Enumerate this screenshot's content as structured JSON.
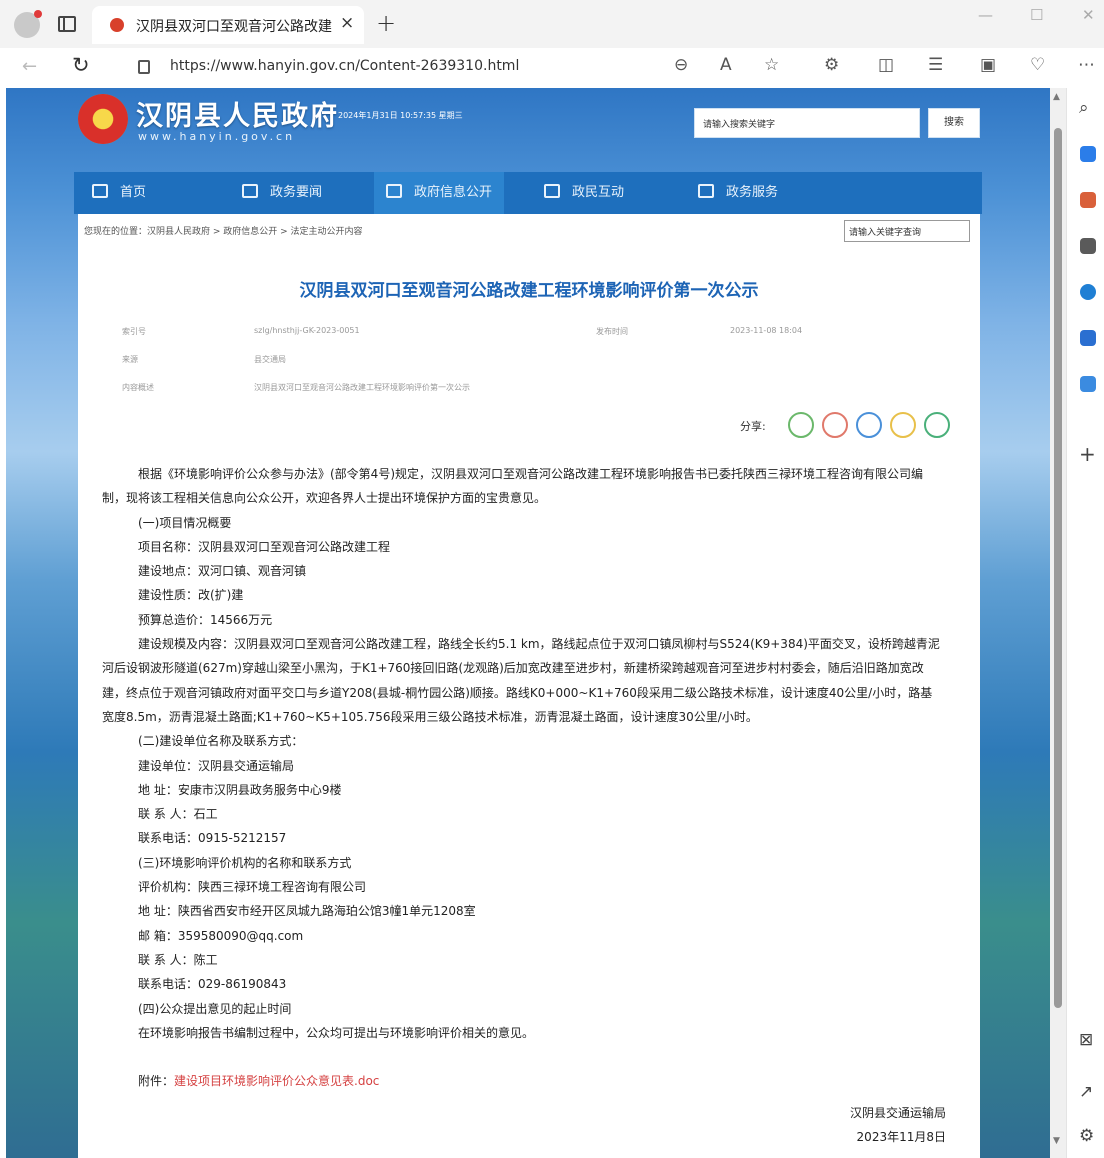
{
  "browser": {
    "tab_title": "汉阴县双河口至观音河公路改建",
    "tab_close": "×",
    "tab_new": "+",
    "url": "https://www.hanyin.gov.cn/Content-2639310.html",
    "window": {
      "minimize": "—",
      "maximize": "☐",
      "close": "✕"
    }
  },
  "site": {
    "name": "汉阴县人民政府",
    "domain": "www.hanyin.gov.cn",
    "datetime": "2024年1月31日 10:57:35 星期三",
    "search_placeholder": "请输入搜索关键字",
    "search_button": "搜索"
  },
  "nav": {
    "items": [
      {
        "label": "首页",
        "icon": "home-icon"
      },
      {
        "label": "政务要闻",
        "icon": "news-icon"
      },
      {
        "label": "政府信息公开",
        "icon": "info-icon"
      },
      {
        "label": "政民互动",
        "icon": "chat-icon"
      },
      {
        "label": "政务服务",
        "icon": "service-icon"
      }
    ]
  },
  "breadcrumb": "您现在的位置：汉阴县人民政府 > 政府信息公开 > 法定主动公开内容",
  "keyword_search_placeholder": "请输入关键字查询",
  "article": {
    "title": "汉阴县双河口至观音河公路改建工程环境影响评价第一次公示",
    "meta": {
      "index_label": "索引号",
      "index_value": "szlg/hnsthjj-GK-2023-0051",
      "date_label": "发布时间",
      "date_value": "2023-11-08 18:04",
      "source_label": "来源",
      "source_value": "县交通局",
      "summary_label": "内容概述",
      "summary_value": "汉阴县双河口至观音河公路改建工程环境影响评价第一次公示"
    },
    "share_label": "分享:",
    "paragraphs": [
      "根据《环境影响评价公众参与办法》(部令第4号)规定，汉阴县双河口至观音河公路改建工程环境影响报告书已委托陕西三禄环境工程咨询有限公司编",
      "制，现将该工程相关信息向公众公开，欢迎各界人士提出环境保护方面的宝贵意见。",
      "(一)项目情况概要",
      "项目名称：汉阴县双河口至观音河公路改建工程",
      "建设地点：双河口镇、观音河镇",
      "建设性质：改(扩)建",
      "预算总造价：14566万元",
      "建设规模及内容：汉阴县双河口至观音河公路改建工程，路线全长约5.1 km，路线起点位于双河口镇凤柳村与S524(K9+384)平面交叉，设桥跨越青泥",
      "河后设钢波形隧道(627m)穿越山梁至小黑沟，于K1+760接回旧路(龙观路)后加宽改建至进步村，新建桥梁跨越观音河至进步村村委会，随后沿旧路加宽改",
      "建，终点位于观音河镇政府对面平交口与乡道Y208(县城-桐竹园公路)顺接。路线K0+000~K1+760段采用二级公路技术标准，设计速度40公里/小时，路基",
      "宽度8.5m，沥青混凝土路面;K1+760~K5+105.756段采用三级公路技术标准，沥青混凝土路面，设计速度30公里/小时。",
      "(二)建设单位名称及联系方式：",
      "建设单位：汉阴县交通运输局",
      "地 址：安康市汉阴县政务服务中心9楼",
      "联 系 人：石工",
      "联系电话：0915-5212157",
      "(三)环境影响评价机构的名称和联系方式",
      "评价机构：陕西三禄环境工程咨询有限公司",
      "地 址：陕西省西安市经开区凤城九路海珀公馆3幢1单元1208室",
      "邮 箱：359580090@qq.com",
      "联 系 人：陈工",
      "联系电话：029-86190843",
      "(四)公众提出意见的起止时间",
      "在环境影响报告书编制过程中，公众均可提出与环境影响评价相关的意见。"
    ],
    "attachment_label": "附件：",
    "attachment_link": "建设项目环境影响评价公众意见表.doc",
    "signature_org": "汉阴县交通运输局",
    "signature_date": "2023年11月8日"
  },
  "colors": {
    "nav_blue": "#1e6fbd",
    "title_blue": "#1d64b5",
    "attachment_red": "#d54242"
  }
}
